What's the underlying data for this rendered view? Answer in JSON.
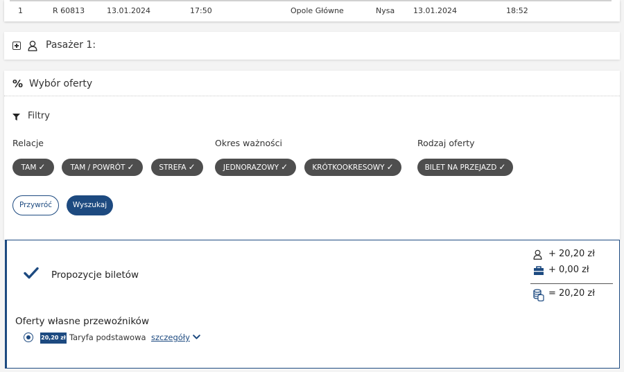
{
  "table_row": {
    "index": "1",
    "train": "R 60813",
    "dep_date": "13.01.2024",
    "dep_time": "17:50",
    "from": "Opole Główne",
    "to": "Nysa",
    "arr_date": "13.01.2024",
    "arr_time": "18:52"
  },
  "passenger": {
    "label": "Pasażer 1:",
    "icons": {
      "expand": "plus-square-icon",
      "person": "user-icon"
    }
  },
  "offer": {
    "title": "Wybór oferty",
    "icon": "percent-icon",
    "filters_title": "Filtry",
    "filters_icon": "filter-funnel-icon",
    "groups": {
      "relacje": "Relacje",
      "okres": "Okres ważności",
      "rodzaj": "Rodzaj oferty"
    },
    "chips": {
      "tam": "TAM",
      "tam_powrot": "TAM / POWRÓT",
      "strefa": "STREFA",
      "jednorazowy": "JEDNORAZOWY",
      "krotkookresowy": "KRÓTKOOKRESOWY",
      "bilet": "BILET NA PRZEJAZD",
      "check": "✓"
    },
    "reset_label": "Przywróć",
    "search_label": "Wyszukaj"
  },
  "proposals": {
    "title": "Propozycje biletów",
    "own_offers_title": "Oferty własne przewoźników",
    "fare": {
      "price": "20,20 zł",
      "name": "Taryfa podstawowa",
      "details_label": "szczegóły"
    },
    "summary": {
      "passenger_amount": "+ 20,20 zł",
      "luggage_amount": "+ 0,00 zł",
      "total": "= 20,20 zł"
    }
  },
  "colors": {
    "accent": "#1d4a80",
    "chip": "#4e4e4e"
  }
}
